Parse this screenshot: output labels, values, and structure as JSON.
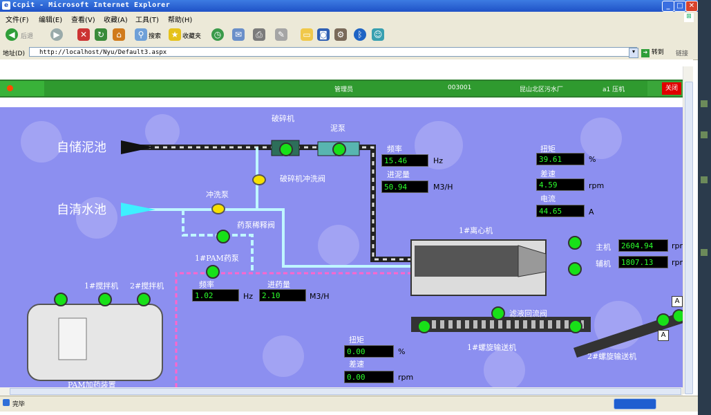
{
  "window": {
    "title": "Ccpit - Microsoft Internet Explorer",
    "min": "_",
    "max": "□",
    "close": "✕"
  },
  "menu": [
    "文件(F)",
    "编辑(E)",
    "查看(V)",
    "收藏(A)",
    "工具(T)",
    "帮助(H)"
  ],
  "toolbar": {
    "back": "后退",
    "search": "搜索",
    "favorites": "收藏夹"
  },
  "address": {
    "label": "地址(D)",
    "url": "http://localhost/Nyu/Default3.aspx",
    "go": "转到",
    "links": "链接"
  },
  "header": {
    "user_role": "管理员",
    "code": "003001",
    "plant": "昆山北区污水厂",
    "device": "a1 压机",
    "close_label": "关闭"
  },
  "sources": {
    "sludge": "自储泥池",
    "water": "自清水池"
  },
  "equipment": {
    "crusher": "破碎机",
    "sludge_pump": "泥泵",
    "crusher_flush_valve": "破碎机冲洗阀",
    "flush_pump": "冲洗泵",
    "dilution_valve": "药泵稀释阀",
    "pam_pump": "1#PAM药泵",
    "mixer1": "1#搅拌机",
    "mixer2": "2#搅拌机",
    "pam_device": "PAM加药装置",
    "centrifuge": "1#离心机",
    "main_motor": "主机",
    "aux_motor": "辅机",
    "return_valve": "滤液回流阀",
    "conveyor1": "1#螺旋输送机",
    "conveyor2": "2#螺旋输送机",
    "mode_a1": "A",
    "mode_a2": "A"
  },
  "readings": {
    "freq_label": "频率",
    "freq": "15.46",
    "freq_unit": "Hz",
    "sludge_flow_label": "进泥量",
    "sludge_flow": "50.94",
    "sludge_flow_unit": "M3/H",
    "torque_label": "扭矩",
    "torque": "39.61",
    "torque_unit": "%",
    "diff_label": "差速",
    "diff": "4.59",
    "diff_unit": "rpm",
    "current_label": "电流",
    "current": "44.65",
    "current_unit": "A",
    "main_speed": "2604.94",
    "main_unit": "rpm",
    "aux_speed": "1807.13",
    "aux_unit": "rpm",
    "pam_freq_label": "频率",
    "pam_freq": "1.02",
    "pam_freq_unit": "Hz",
    "dose_label": "进药量",
    "dose": "2.10",
    "dose_unit": "M3/H",
    "conv_torque_label": "扭矩",
    "conv_torque": "0.00",
    "conv_torque_unit": "%",
    "conv_diff_label": "差速",
    "conv_diff": "0.00",
    "conv_diff_unit": "rpm"
  },
  "status": {
    "done": "完毕"
  },
  "colors": {
    "hmi_bg": "#8c8ff0",
    "pipe_sludge": "#222222",
    "pipe_water": "#bff6ff",
    "pipe_pam": "#ff66cc",
    "running": "#18e018",
    "value_text": "#2cff2c"
  }
}
